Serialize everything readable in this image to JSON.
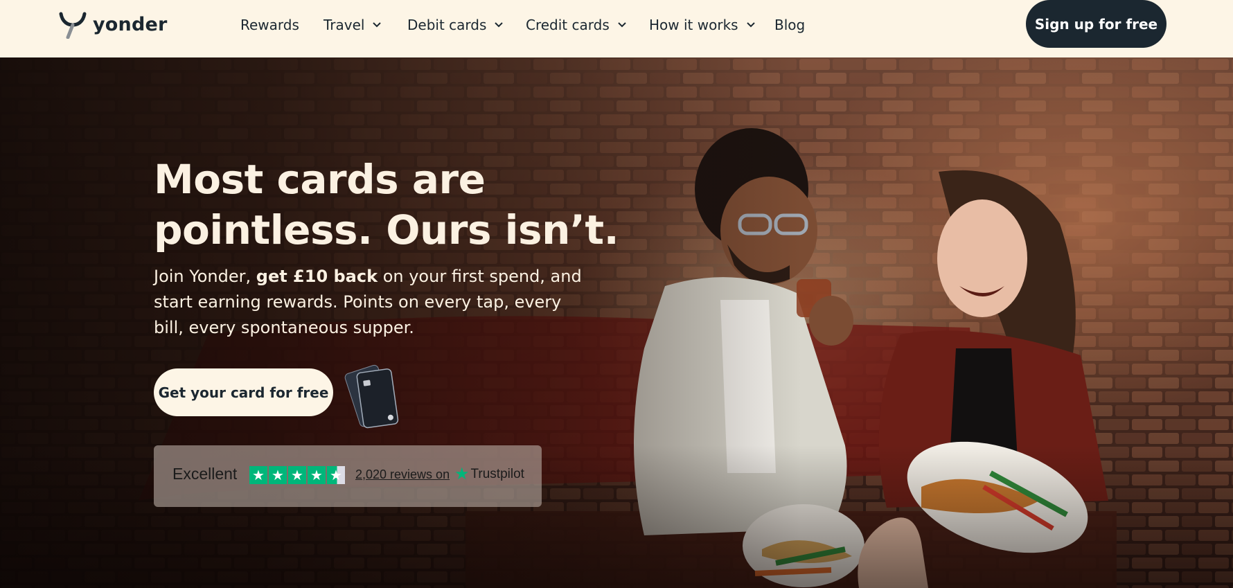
{
  "nav": {
    "brand": "yonder",
    "items": [
      {
        "label": "Rewards",
        "dropdown": false
      },
      {
        "label": "Travel",
        "dropdown": true
      },
      {
        "label": "Debit cards",
        "dropdown": true
      },
      {
        "label": "Credit cards",
        "dropdown": true
      },
      {
        "label": "How it works",
        "dropdown": true
      },
      {
        "label": "Blog",
        "dropdown": false
      }
    ],
    "signup_label": "Sign up for free"
  },
  "hero": {
    "headline_line1": "Most cards are",
    "headline_line2": "pointless. Ours isn’t.",
    "sub_intro": "Join Yonder, ",
    "sub_bold": "get £10 back",
    "sub_rest": " on your first spend, and start earning rewards. Points on every tap, every bill, every spontaneous supper.",
    "cta_label": "Get your card for free"
  },
  "trustpilot": {
    "rating_text": "Excellent",
    "stars": 4.5,
    "reviews_link": "2,020 reviews on",
    "brand": "Trustpilot"
  },
  "colors": {
    "nav_bg": "#fdf5e6",
    "dark": "#1b2730",
    "cream": "#fbf1e2",
    "trustpilot_green": "#00b67a"
  }
}
